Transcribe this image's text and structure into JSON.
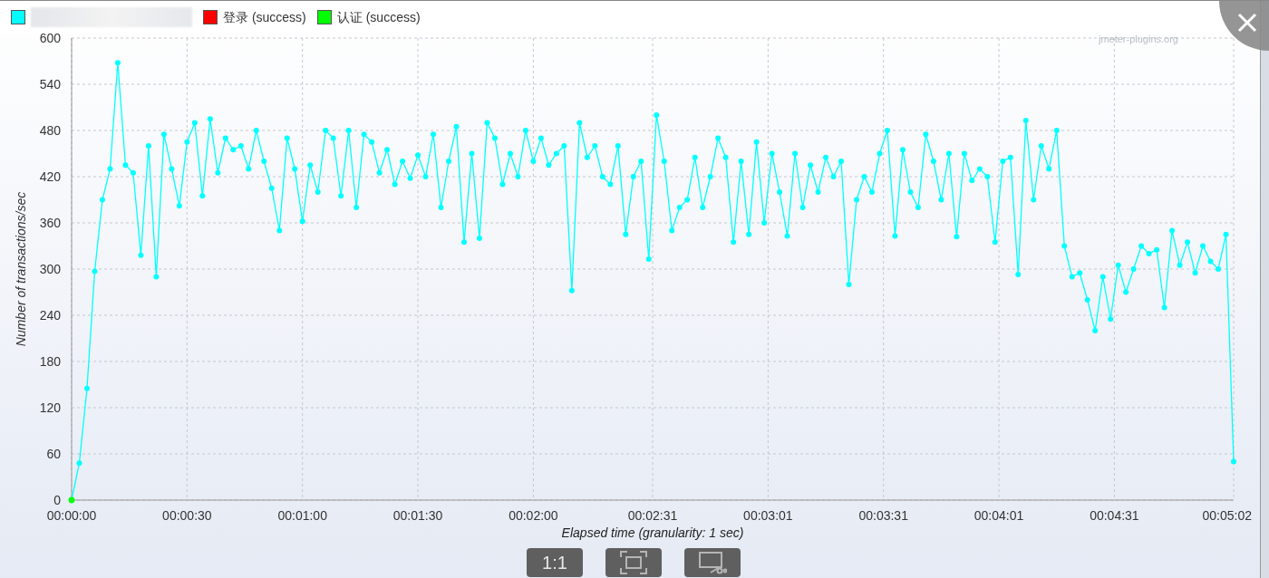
{
  "legend": [
    {
      "kind": "blurred",
      "color": "#00ffff"
    },
    {
      "kind": "label",
      "color": "#ff0000",
      "label": "登录 (success)"
    },
    {
      "kind": "label",
      "color": "#00ff00",
      "label": "认证 (success)"
    }
  ],
  "chart": {
    "watermark": "jmeter-plugins.org",
    "chart_data": {
      "type": "line",
      "xlabel": "Elapsed time (granularity: 1 sec)",
      "ylabel": "Number of transactions/sec",
      "x": [
        0,
        2,
        4,
        6,
        8,
        10,
        12,
        14,
        16,
        18,
        20,
        22,
        24,
        26,
        28,
        30,
        32,
        34,
        36,
        38,
        40,
        42,
        44,
        46,
        48,
        50,
        52,
        54,
        56,
        58,
        60,
        62,
        64,
        66,
        68,
        70,
        72,
        74,
        76,
        78,
        80,
        82,
        84,
        86,
        88,
        90,
        92,
        94,
        96,
        98,
        100,
        102,
        104,
        106,
        108,
        110,
        112,
        114,
        116,
        118,
        120,
        122,
        124,
        126,
        128,
        130,
        132,
        134,
        136,
        138,
        140,
        142,
        144,
        146,
        148,
        150,
        152,
        154,
        156,
        158,
        160,
        162,
        164,
        166,
        168,
        170,
        172,
        174,
        176,
        178,
        180,
        182,
        184,
        186,
        188,
        190,
        192,
        194,
        196,
        198,
        200,
        202,
        204,
        206,
        208,
        210,
        212,
        214,
        216,
        218,
        220,
        222,
        224,
        226,
        228,
        230,
        232,
        234,
        236,
        238,
        240,
        242,
        244,
        246,
        248,
        250,
        252,
        254,
        256,
        258,
        260,
        262,
        264,
        266,
        268,
        270,
        272,
        274,
        276,
        278,
        280,
        282,
        284,
        286,
        288,
        290,
        292,
        294,
        296,
        298,
        300,
        302
      ],
      "series": [
        {
          "color": "#00ffff",
          "marker": "circle",
          "values": [
            0,
            48,
            145,
            297,
            390,
            430,
            568,
            435,
            425,
            318,
            460,
            290,
            475,
            430,
            382,
            465,
            490,
            395,
            495,
            425,
            470,
            455,
            460,
            430,
            480,
            440,
            405,
            350,
            470,
            430,
            362,
            435,
            400,
            480,
            470,
            395,
            480,
            380,
            475,
            465,
            425,
            455,
            410,
            440,
            418,
            448,
            420,
            475,
            380,
            440,
            485,
            335,
            450,
            340,
            490,
            470,
            410,
            450,
            420,
            480,
            440,
            470,
            435,
            450,
            460,
            272,
            490,
            445,
            460,
            420,
            410,
            460,
            345,
            420,
            440,
            313,
            500,
            440,
            350,
            380,
            390,
            445,
            380,
            420,
            470,
            445,
            335,
            440,
            345,
            465,
            360,
            450,
            400,
            343,
            450,
            380,
            435,
            400,
            445,
            420,
            440,
            280,
            390,
            420,
            400,
            450,
            480,
            343,
            455,
            400,
            380,
            475,
            440,
            390,
            450,
            342,
            450,
            415,
            430,
            420,
            335,
            440,
            445,
            293,
            493,
            390,
            460,
            430,
            480,
            330,
            290,
            295,
            260,
            220,
            290,
            235,
            305,
            270,
            300,
            330,
            320,
            325,
            250,
            350,
            305,
            335,
            295,
            330,
            310,
            300,
            345,
            50
          ]
        },
        {
          "color": "#00ff00",
          "marker": "circle",
          "values": [
            0,
            null,
            null,
            null,
            null,
            null,
            null,
            null,
            null,
            null,
            null,
            null,
            null,
            null,
            null,
            null,
            null,
            null,
            null,
            null,
            null,
            null,
            null,
            null,
            null,
            null,
            null,
            null,
            null,
            null,
            null,
            null,
            null,
            null,
            null,
            null,
            null,
            null,
            null,
            null,
            null,
            null,
            null,
            null,
            null,
            null,
            null,
            null,
            null,
            null,
            null,
            null,
            null,
            null,
            null,
            null,
            null,
            null,
            null,
            null,
            null,
            null,
            null,
            null,
            null,
            null,
            null,
            null,
            null,
            null,
            null,
            null,
            null,
            null,
            null,
            null,
            null,
            null,
            null,
            null,
            null,
            null,
            null,
            null,
            null,
            null,
            null,
            null,
            null,
            null,
            null,
            null,
            null,
            null,
            null,
            null,
            null,
            null,
            null,
            null,
            null,
            null,
            null,
            null,
            null,
            null,
            null,
            null,
            null,
            null,
            null,
            null,
            null,
            null,
            null,
            null,
            null,
            null,
            null,
            null,
            null,
            null,
            null,
            null,
            null,
            null,
            null,
            null,
            null,
            null,
            null,
            null,
            null,
            null,
            null,
            null,
            null,
            null,
            null,
            null,
            null,
            null,
            null,
            null,
            null,
            null,
            null,
            null,
            null,
            null,
            null,
            null
          ]
        }
      ],
      "grid": true,
      "xlim": [
        0,
        302
      ],
      "ylim": [
        0,
        600
      ],
      "yticks": [
        0,
        60,
        120,
        180,
        240,
        300,
        360,
        420,
        480,
        540,
        600
      ],
      "xticks": [
        {
          "value": 0,
          "label": "00:00:00"
        },
        {
          "value": 30,
          "label": "00:00:30"
        },
        {
          "value": 60,
          "label": "00:01:00"
        },
        {
          "value": 90,
          "label": "00:01:30"
        },
        {
          "value": 120,
          "label": "00:02:00"
        },
        {
          "value": 151,
          "label": "00:02:31"
        },
        {
          "value": 181,
          "label": "00:03:01"
        },
        {
          "value": 211,
          "label": "00:03:31"
        },
        {
          "value": 241,
          "label": "00:04:01"
        },
        {
          "value": 271,
          "label": "00:04:31"
        },
        {
          "value": 302,
          "label": "00:05:02"
        }
      ]
    }
  },
  "viewer_controls": [
    {
      "kind": "actual-size",
      "label": "1:1"
    },
    {
      "kind": "fit"
    },
    {
      "kind": "crop"
    }
  ]
}
